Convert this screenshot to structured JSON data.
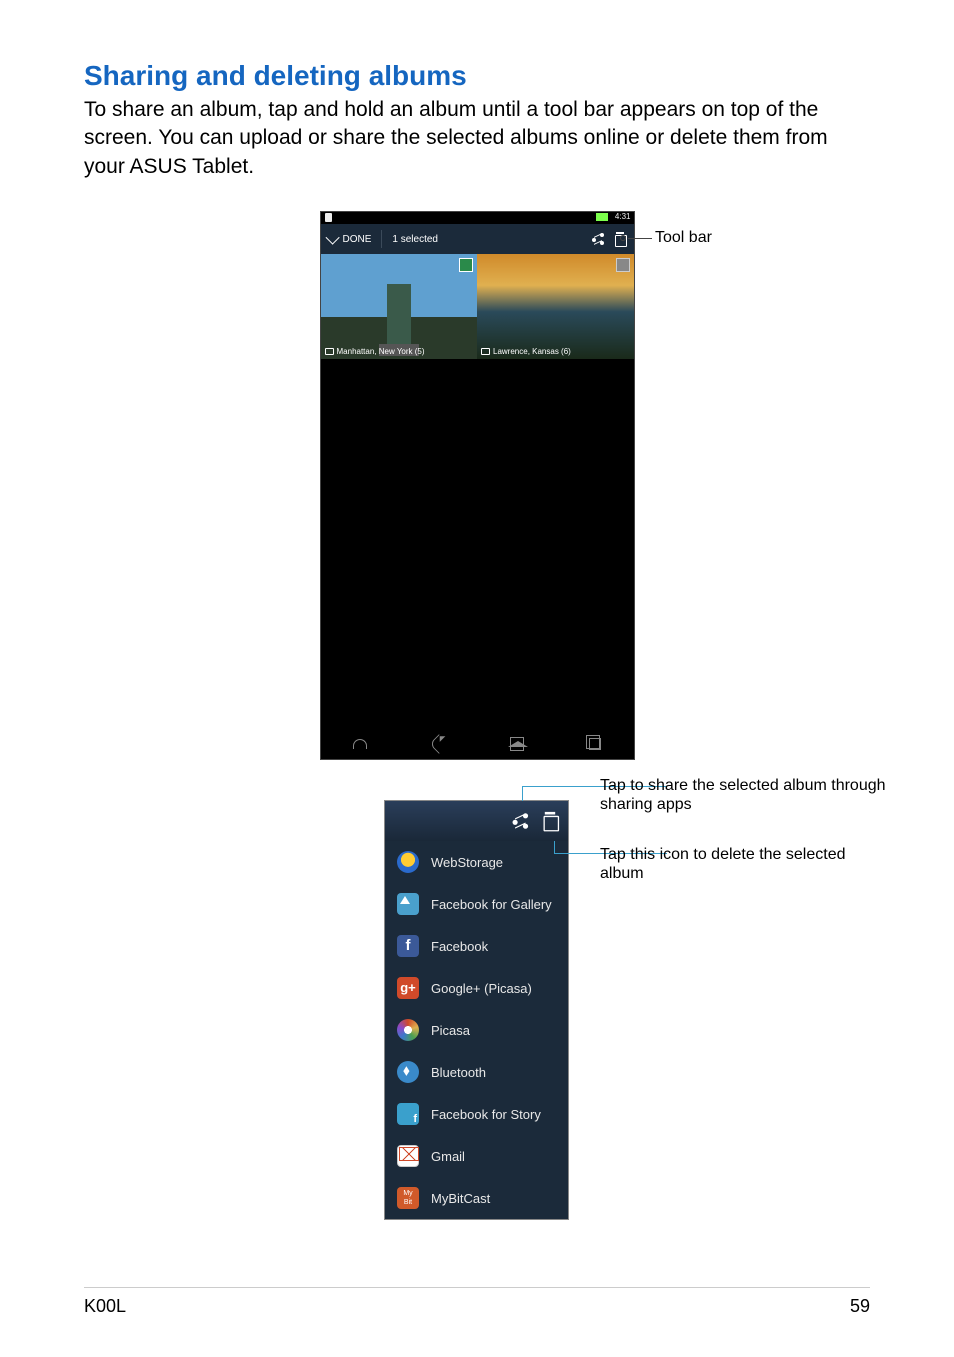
{
  "heading": "Sharing and deleting albums",
  "intro": "To share an album, tap and hold an album until a tool bar appears on top of the screen. You can upload or share the selected albums online or delete them from your ASUS Tablet.",
  "fig1": {
    "status_time": "4:31",
    "toolbar": {
      "done": "DONE",
      "selected": "1 selected"
    },
    "album1_label": "Manhattan, New York (5)",
    "album2_label": "Lawrence, Kansas (6)",
    "callout_toolbar": "Tool bar"
  },
  "fig2": {
    "callout_share": "Tap to share the selected album through sharing apps",
    "callout_delete": "Tap this icon to delete the selected album",
    "items": [
      "WebStorage",
      "Facebook for Gallery",
      "Facebook",
      "Google+ (Picasa)",
      "Picasa",
      "Bluetooth",
      "Facebook for Story",
      "Gmail",
      "MyBitCast"
    ]
  },
  "footer": {
    "left": "K00L",
    "right": "59"
  }
}
